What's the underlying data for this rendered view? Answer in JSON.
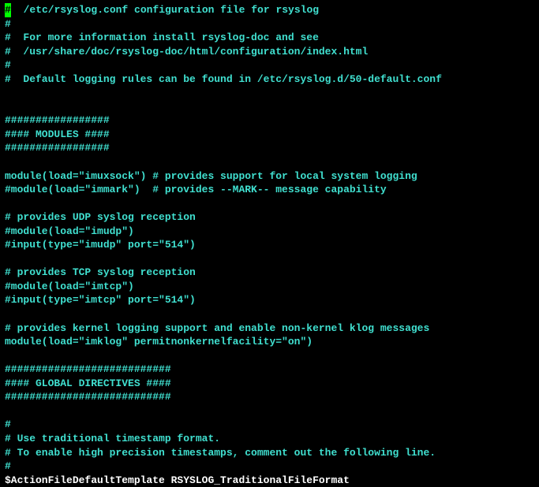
{
  "lines": [
    {
      "text": "  /etc/rsyslog.conf configuration file for rsyslog",
      "hasCursor": true,
      "cursorChar": "#"
    },
    {
      "text": "#"
    },
    {
      "text": "#  For more information install rsyslog-doc and see"
    },
    {
      "text": "#  /usr/share/doc/rsyslog-doc/html/configuration/index.html"
    },
    {
      "text": "#"
    },
    {
      "text": "#  Default logging rules can be found in /etc/rsyslog.d/50-default.conf"
    },
    {
      "text": ""
    },
    {
      "text": ""
    },
    {
      "text": "#################"
    },
    {
      "text": "#### MODULES ####"
    },
    {
      "text": "#################"
    },
    {
      "text": ""
    },
    {
      "text": "module(load=\"imuxsock\") # provides support for local system logging"
    },
    {
      "text": "#module(load=\"immark\")  # provides --MARK-- message capability"
    },
    {
      "text": ""
    },
    {
      "text": "# provides UDP syslog reception"
    },
    {
      "text": "#module(load=\"imudp\")"
    },
    {
      "text": "#input(type=\"imudp\" port=\"514\")"
    },
    {
      "text": ""
    },
    {
      "text": "# provides TCP syslog reception"
    },
    {
      "text": "#module(load=\"imtcp\")"
    },
    {
      "text": "#input(type=\"imtcp\" port=\"514\")"
    },
    {
      "text": ""
    },
    {
      "text": "# provides kernel logging support and enable non-kernel klog messages"
    },
    {
      "text": "module(load=\"imklog\" permitnonkernelfacility=\"on\")"
    },
    {
      "text": ""
    },
    {
      "text": "###########################"
    },
    {
      "text": "#### GLOBAL DIRECTIVES ####"
    },
    {
      "text": "###########################"
    },
    {
      "text": ""
    },
    {
      "text": "#"
    },
    {
      "text": "# Use traditional timestamp format."
    },
    {
      "text": "# To enable high precision timestamps, comment out the following line."
    },
    {
      "text": "#"
    },
    {
      "text": "$ActionFileDefaultTemplate RSYSLOG_TraditionalFileFormat",
      "isDollarDirective": true
    }
  ]
}
